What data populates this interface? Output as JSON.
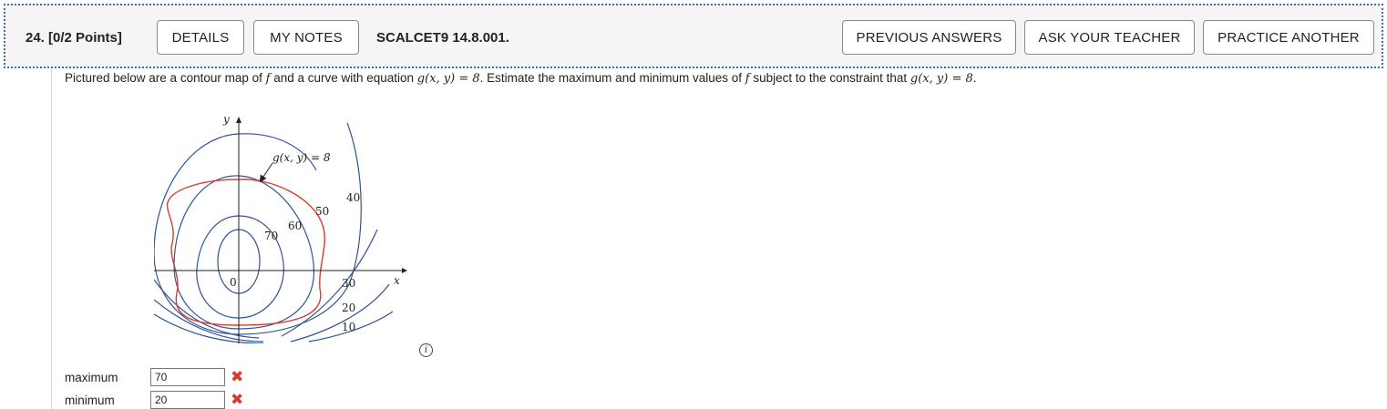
{
  "header": {
    "question_number": "24.",
    "points": "[0/2 Points]",
    "details_label": "DETAILS",
    "my_notes_label": "MY NOTES",
    "reference": "SCALCET9 14.8.001.",
    "previous_answers_label": "PREVIOUS ANSWERS",
    "ask_teacher_label": "ASK YOUR TEACHER",
    "practice_another_label": "PRACTICE ANOTHER"
  },
  "question": {
    "text_1": "Pictured below are a contour map of ",
    "f1": "f",
    "text_2": " and a curve with equation ",
    "eq1": "g(x, y) = 8",
    "text_3": ". Estimate the maximum and minimum values of ",
    "f2": "f",
    "text_4": " subject to the constraint that ",
    "eq2": "g(x, y) = 8",
    "text_5": "."
  },
  "figure": {
    "y_axis": "y",
    "x_axis": "x",
    "origin": "0",
    "curve_label": "g(x, y) = 8",
    "contour_labels": [
      "70",
      "60",
      "50",
      "40",
      "30",
      "20",
      "10"
    ],
    "contour_color": "#2f5597",
    "constraint_color": "#d93a2f",
    "info_icon": "info-icon"
  },
  "answers": {
    "maximum_label": "maximum",
    "maximum_value": "70",
    "minimum_label": "minimum",
    "minimum_value": "20",
    "status_icon": "incorrect-x-icon"
  }
}
